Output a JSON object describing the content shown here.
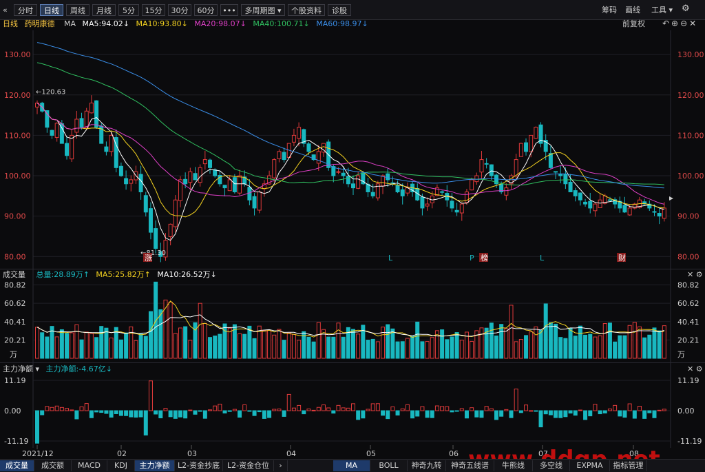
{
  "toolbar": {
    "collapse_icon": "«",
    "tabs": [
      {
        "label": "分时",
        "active": false
      },
      {
        "label": "日线",
        "active": true
      },
      {
        "label": "周线",
        "active": false
      },
      {
        "label": "月线",
        "active": false
      },
      {
        "label": "5分",
        "active": false
      },
      {
        "label": "15分",
        "active": false
      },
      {
        "label": "30分",
        "active": false
      },
      {
        "label": "60分",
        "active": false
      },
      {
        "label": "•••",
        "active": false
      },
      {
        "label": "多周期图 ▾",
        "active": false
      },
      {
        "label": "个股资料",
        "active": false
      },
      {
        "label": "诊股",
        "active": false
      }
    ],
    "right_items": [
      "筹码",
      "画线",
      "工具 ▾"
    ],
    "settings_icon": "⚙"
  },
  "kline_legend": {
    "period": "日线",
    "stock": "药明康德",
    "ma_label": "MA",
    "ma5": "MA5:94.02↓",
    "ma10": "MA10:93.80↓",
    "ma20": "MA20:98.07↓",
    "ma40": "MA40:100.71↓",
    "ma60": "MA60:98.97↓",
    "fq": "前复权",
    "colors": {
      "ma5": "#ffffff",
      "ma10": "#f5d320",
      "ma20": "#e040c8",
      "ma40": "#30c060",
      "ma60": "#3a8ee8"
    }
  },
  "kline_axis": [
    "130.00",
    "120.00",
    "110.00",
    "100.00",
    "90.00",
    "80.00"
  ],
  "kline_annotations": {
    "high": "←120.63",
    "low": "←81.30"
  },
  "kline_markers": [
    {
      "text": "涨",
      "kind": "box"
    },
    {
      "text": "L",
      "kind": "plain"
    },
    {
      "text": "P",
      "kind": "plain"
    },
    {
      "text": "榜",
      "kind": "box"
    },
    {
      "text": "L",
      "kind": "plain"
    },
    {
      "text": "财",
      "kind": "box"
    }
  ],
  "volume_legend": {
    "title": "成交量",
    "total": "总量:28.89万↑",
    "ma5": "MA5:25.82万↑",
    "ma10": "MA10:26.52万↓"
  },
  "volume_axis": [
    "80.82",
    "60.62",
    "40.41",
    "20.21",
    "万"
  ],
  "flow_legend": {
    "title": "主力净额 ▾",
    "value": "主力净额:-4.67亿↓"
  },
  "flow_axis": [
    "11.19",
    "0.00",
    "-11.19"
  ],
  "date_axis": [
    "2021/12",
    "02",
    "03",
    "04",
    "05",
    "06",
    "07",
    "08"
  ],
  "bottom_left_tabs": [
    {
      "label": "成交量",
      "active": true
    },
    {
      "label": "成交额",
      "active": false
    },
    {
      "label": "MACD",
      "active": false
    },
    {
      "label": "KDJ",
      "active": false
    },
    {
      "label": "主力净额",
      "active": true
    },
    {
      "label": "L2-资金抄底",
      "active": false
    },
    {
      "label": "L2-资金仓位",
      "active": false
    }
  ],
  "bottom_right_tabs": [
    {
      "label": "MA",
      "active": true
    },
    {
      "label": "BOLL",
      "active": false
    },
    {
      "label": "神奇九转",
      "active": false
    },
    {
      "label": "神奇五线谱",
      "active": false
    },
    {
      "label": "牛熊线",
      "active": false
    },
    {
      "label": "多空线",
      "active": false
    },
    {
      "label": "EXPMA",
      "active": false
    },
    {
      "label": "指标管理",
      "active": false
    }
  ],
  "watermark": "www.ddgp.net",
  "colors": {
    "up": "#e03a3a",
    "down": "#19b8c0",
    "grid": "#1f1f26"
  },
  "chart_data": {
    "type": "candlestick",
    "title": "",
    "y_range": [
      78,
      136
    ],
    "x_labels": [
      "2021/12",
      "02",
      "03",
      "04",
      "05",
      "06",
      "07",
      "08"
    ],
    "close_series": [
      118,
      116,
      112,
      110,
      113,
      108,
      105,
      110,
      114,
      112,
      116,
      118,
      112,
      108,
      106,
      110,
      102,
      100,
      98,
      99,
      101,
      96,
      91,
      86,
      82,
      80,
      84,
      88,
      94,
      99,
      98,
      101,
      99,
      102,
      104,
      102,
      100,
      98,
      97,
      99,
      96,
      100,
      98,
      94,
      92,
      96,
      98,
      100,
      104,
      106,
      104,
      108,
      110,
      112,
      108,
      106,
      104,
      106,
      108,
      102,
      100,
      101,
      100,
      98,
      97,
      100,
      98,
      96,
      95,
      98,
      100,
      99,
      98,
      96,
      95,
      97,
      96,
      94,
      92,
      93,
      95,
      97,
      96,
      94,
      92,
      91,
      93,
      96,
      99,
      100,
      104,
      103,
      100,
      98,
      96,
      97,
      100,
      104,
      108,
      106,
      110,
      112,
      108,
      106,
      102,
      101,
      100,
      98,
      96,
      95,
      94,
      93,
      92,
      93,
      94,
      95,
      94,
      93,
      92,
      91,
      92,
      93,
      94,
      93,
      92,
      91,
      90,
      92
    ]
  }
}
